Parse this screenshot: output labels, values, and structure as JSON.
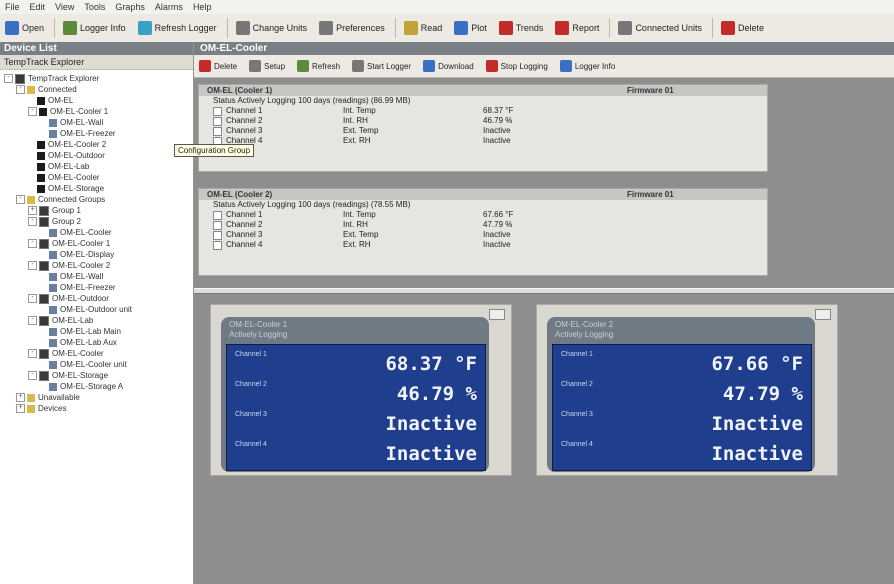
{
  "menu": [
    "File",
    "Edit",
    "View",
    "Tools",
    "Graphs",
    "Alarms",
    "Help"
  ],
  "toolbar": [
    {
      "label": "Open",
      "icon": "open-icon",
      "color": "#3a6fc4"
    },
    {
      "label": "Logger Info",
      "icon": "logger-info-icon",
      "color": "#5c8a3a"
    },
    {
      "label": "Refresh Logger",
      "icon": "refresh-icon",
      "color": "#3aa0c4"
    },
    {
      "label": "Change Units",
      "icon": "units-icon",
      "color": "#777777"
    },
    {
      "label": "Preferences",
      "icon": "preferences-icon",
      "color": "#777777"
    },
    {
      "label": "Read",
      "icon": "read-icon",
      "color": "#c4a23a"
    },
    {
      "label": "Plot",
      "icon": "plot-icon",
      "color": "#3a6fc4"
    },
    {
      "label": "Trends",
      "icon": "trends-icon",
      "color": "#c42a2a"
    },
    {
      "label": "Report",
      "icon": "report-icon",
      "color": "#c42a2a"
    },
    {
      "label": "Connected Units",
      "icon": "connected-icon",
      "color": "#777777"
    },
    {
      "label": "Delete",
      "icon": "delete-icon",
      "color": "#c42a2a"
    }
  ],
  "left_pane": {
    "title": "Device List",
    "subtitle": "TempTrack Explorer"
  },
  "tree": [
    {
      "label": "TempTrack Explorer",
      "level": 0,
      "icon": "pc",
      "expander": "-"
    },
    {
      "label": "Connected",
      "level": 1,
      "icon": "fold",
      "expander": "-"
    },
    {
      "label": "OM-EL",
      "level": 2,
      "icon": "dev",
      "expander": ""
    },
    {
      "label": "OM-EL-Cooler 1",
      "level": 2,
      "icon": "dev",
      "expander": "-"
    },
    {
      "label": "OM-EL-Wall",
      "level": 3,
      "icon": "ch",
      "expander": ""
    },
    {
      "label": "OM-EL-Freezer",
      "level": 3,
      "icon": "ch",
      "expander": ""
    },
    {
      "label": "OM-EL-Cooler 2",
      "level": 2,
      "icon": "dev",
      "expander": ""
    },
    {
      "label": "OM-EL-Outdoor",
      "level": 2,
      "icon": "dev",
      "expander": ""
    },
    {
      "label": "OM-EL-Lab",
      "level": 2,
      "icon": "dev",
      "expander": ""
    },
    {
      "label": "OM-EL-Cooler",
      "level": 2,
      "icon": "dev",
      "expander": ""
    },
    {
      "label": "OM-EL-Storage",
      "level": 2,
      "icon": "dev",
      "expander": ""
    },
    {
      "label": "Connected Groups",
      "level": 1,
      "icon": "fold",
      "expander": "-"
    },
    {
      "label": "Group 1",
      "level": 2,
      "icon": "pc",
      "expander": "+"
    },
    {
      "label": "Group 2",
      "level": 2,
      "icon": "pc",
      "expander": "-"
    },
    {
      "label": "OM-EL-Cooler",
      "level": 3,
      "icon": "ch",
      "expander": ""
    },
    {
      "label": "OM-EL-Cooler 1",
      "level": 2,
      "icon": "pc",
      "expander": "-"
    },
    {
      "label": "OM-EL-Display",
      "level": 3,
      "icon": "ch",
      "expander": ""
    },
    {
      "label": "OM-EL-Cooler 2",
      "level": 2,
      "icon": "pc",
      "expander": "-"
    },
    {
      "label": "OM-EL-Wall",
      "level": 3,
      "icon": "ch",
      "expander": ""
    },
    {
      "label": "OM-EL-Freezer",
      "level": 3,
      "icon": "ch",
      "expander": ""
    },
    {
      "label": "OM-EL-Outdoor",
      "level": 2,
      "icon": "pc",
      "expander": "-"
    },
    {
      "label": "OM-EL-Outdoor unit",
      "level": 3,
      "icon": "ch",
      "expander": ""
    },
    {
      "label": "OM-EL-Lab",
      "level": 2,
      "icon": "pc",
      "expander": "-"
    },
    {
      "label": "OM-EL-Lab Main",
      "level": 3,
      "icon": "ch",
      "expander": ""
    },
    {
      "label": "OM-EL-Lab Aux",
      "level": 3,
      "icon": "ch",
      "expander": ""
    },
    {
      "label": "OM-EL-Cooler",
      "level": 2,
      "icon": "pc",
      "expander": "-"
    },
    {
      "label": "OM-EL-Cooler unit",
      "level": 3,
      "icon": "ch",
      "expander": ""
    },
    {
      "label": "OM-EL-Storage",
      "level": 2,
      "icon": "pc",
      "expander": "-"
    },
    {
      "label": "OM-EL-Storage A",
      "level": 3,
      "icon": "ch",
      "expander": ""
    },
    {
      "label": "Unavailable",
      "level": 1,
      "icon": "fold",
      "expander": "+"
    },
    {
      "label": "Devices",
      "level": 1,
      "icon": "fold",
      "expander": "+"
    }
  ],
  "tooltip": "Configuration Group",
  "right_pane": {
    "title": "OM-EL-Cooler",
    "toolbar": [
      {
        "label": "Delete",
        "icon": "delete-icon",
        "color": "#c42a2a"
      },
      {
        "label": "Setup",
        "icon": "setup-icon",
        "color": "#777777"
      },
      {
        "label": "Refresh",
        "icon": "refresh-icon",
        "color": "#5c8a3a"
      },
      {
        "label": "Start Logger",
        "icon": "start-icon",
        "color": "#777777"
      },
      {
        "label": "Download",
        "icon": "download-icon",
        "color": "#3a6fc4"
      },
      {
        "label": "Stop Logging",
        "icon": "stop-icon",
        "color": "#c42a2a"
      },
      {
        "label": "Logger Info",
        "icon": "info-icon",
        "color": "#3a6fc4"
      }
    ]
  },
  "groups": [
    {
      "title": "OM-EL (Cooler 1)",
      "tag": "Firmware 01",
      "status": "Status   Actively Logging  100 days  (readings) (86.99 MB)",
      "rows": [
        {
          "name": "Channel 1",
          "type": "Int. Temp",
          "value": "68.37 °F"
        },
        {
          "name": "Channel 2",
          "type": "Int. RH",
          "value": "46.79 %"
        },
        {
          "name": "Channel 3",
          "type": "Ext. Temp",
          "value": "Inactive"
        },
        {
          "name": "Channel 4",
          "type": "Ext. RH",
          "value": "Inactive"
        }
      ]
    },
    {
      "title": "OM-EL (Cooler 2)",
      "tag": "Firmware 01",
      "status": "Status   Actively Logging  100 days  (readings) (78.55 MB)",
      "rows": [
        {
          "name": "Channel 1",
          "type": "Int. Temp",
          "value": "67.66 °F"
        },
        {
          "name": "Channel 2",
          "type": "Int. RH",
          "value": "47.79 %"
        },
        {
          "name": "Channel 3",
          "type": "Ext. Temp",
          "value": "Inactive"
        },
        {
          "name": "Channel 4",
          "type": "Ext. RH",
          "value": "Inactive"
        }
      ]
    }
  ],
  "displays": [
    {
      "header": "OM-EL-Cooler 1",
      "subheader": "Actively Logging",
      "rows": [
        {
          "label": "Channel 1",
          "value": "68.37 °F"
        },
        {
          "label": "Channel 2",
          "value": "46.79 %"
        },
        {
          "label": "Channel 3",
          "value": "Inactive"
        },
        {
          "label": "Channel 4",
          "value": "Inactive"
        }
      ]
    },
    {
      "header": "OM-EL-Cooler 2",
      "subheader": "Actively Logging",
      "rows": [
        {
          "label": "Channel 1",
          "value": "67.66 °F"
        },
        {
          "label": "Channel 2",
          "value": "47.79 %"
        },
        {
          "label": "Channel 3",
          "value": "Inactive"
        },
        {
          "label": "Channel 4",
          "value": "Inactive"
        }
      ]
    }
  ]
}
